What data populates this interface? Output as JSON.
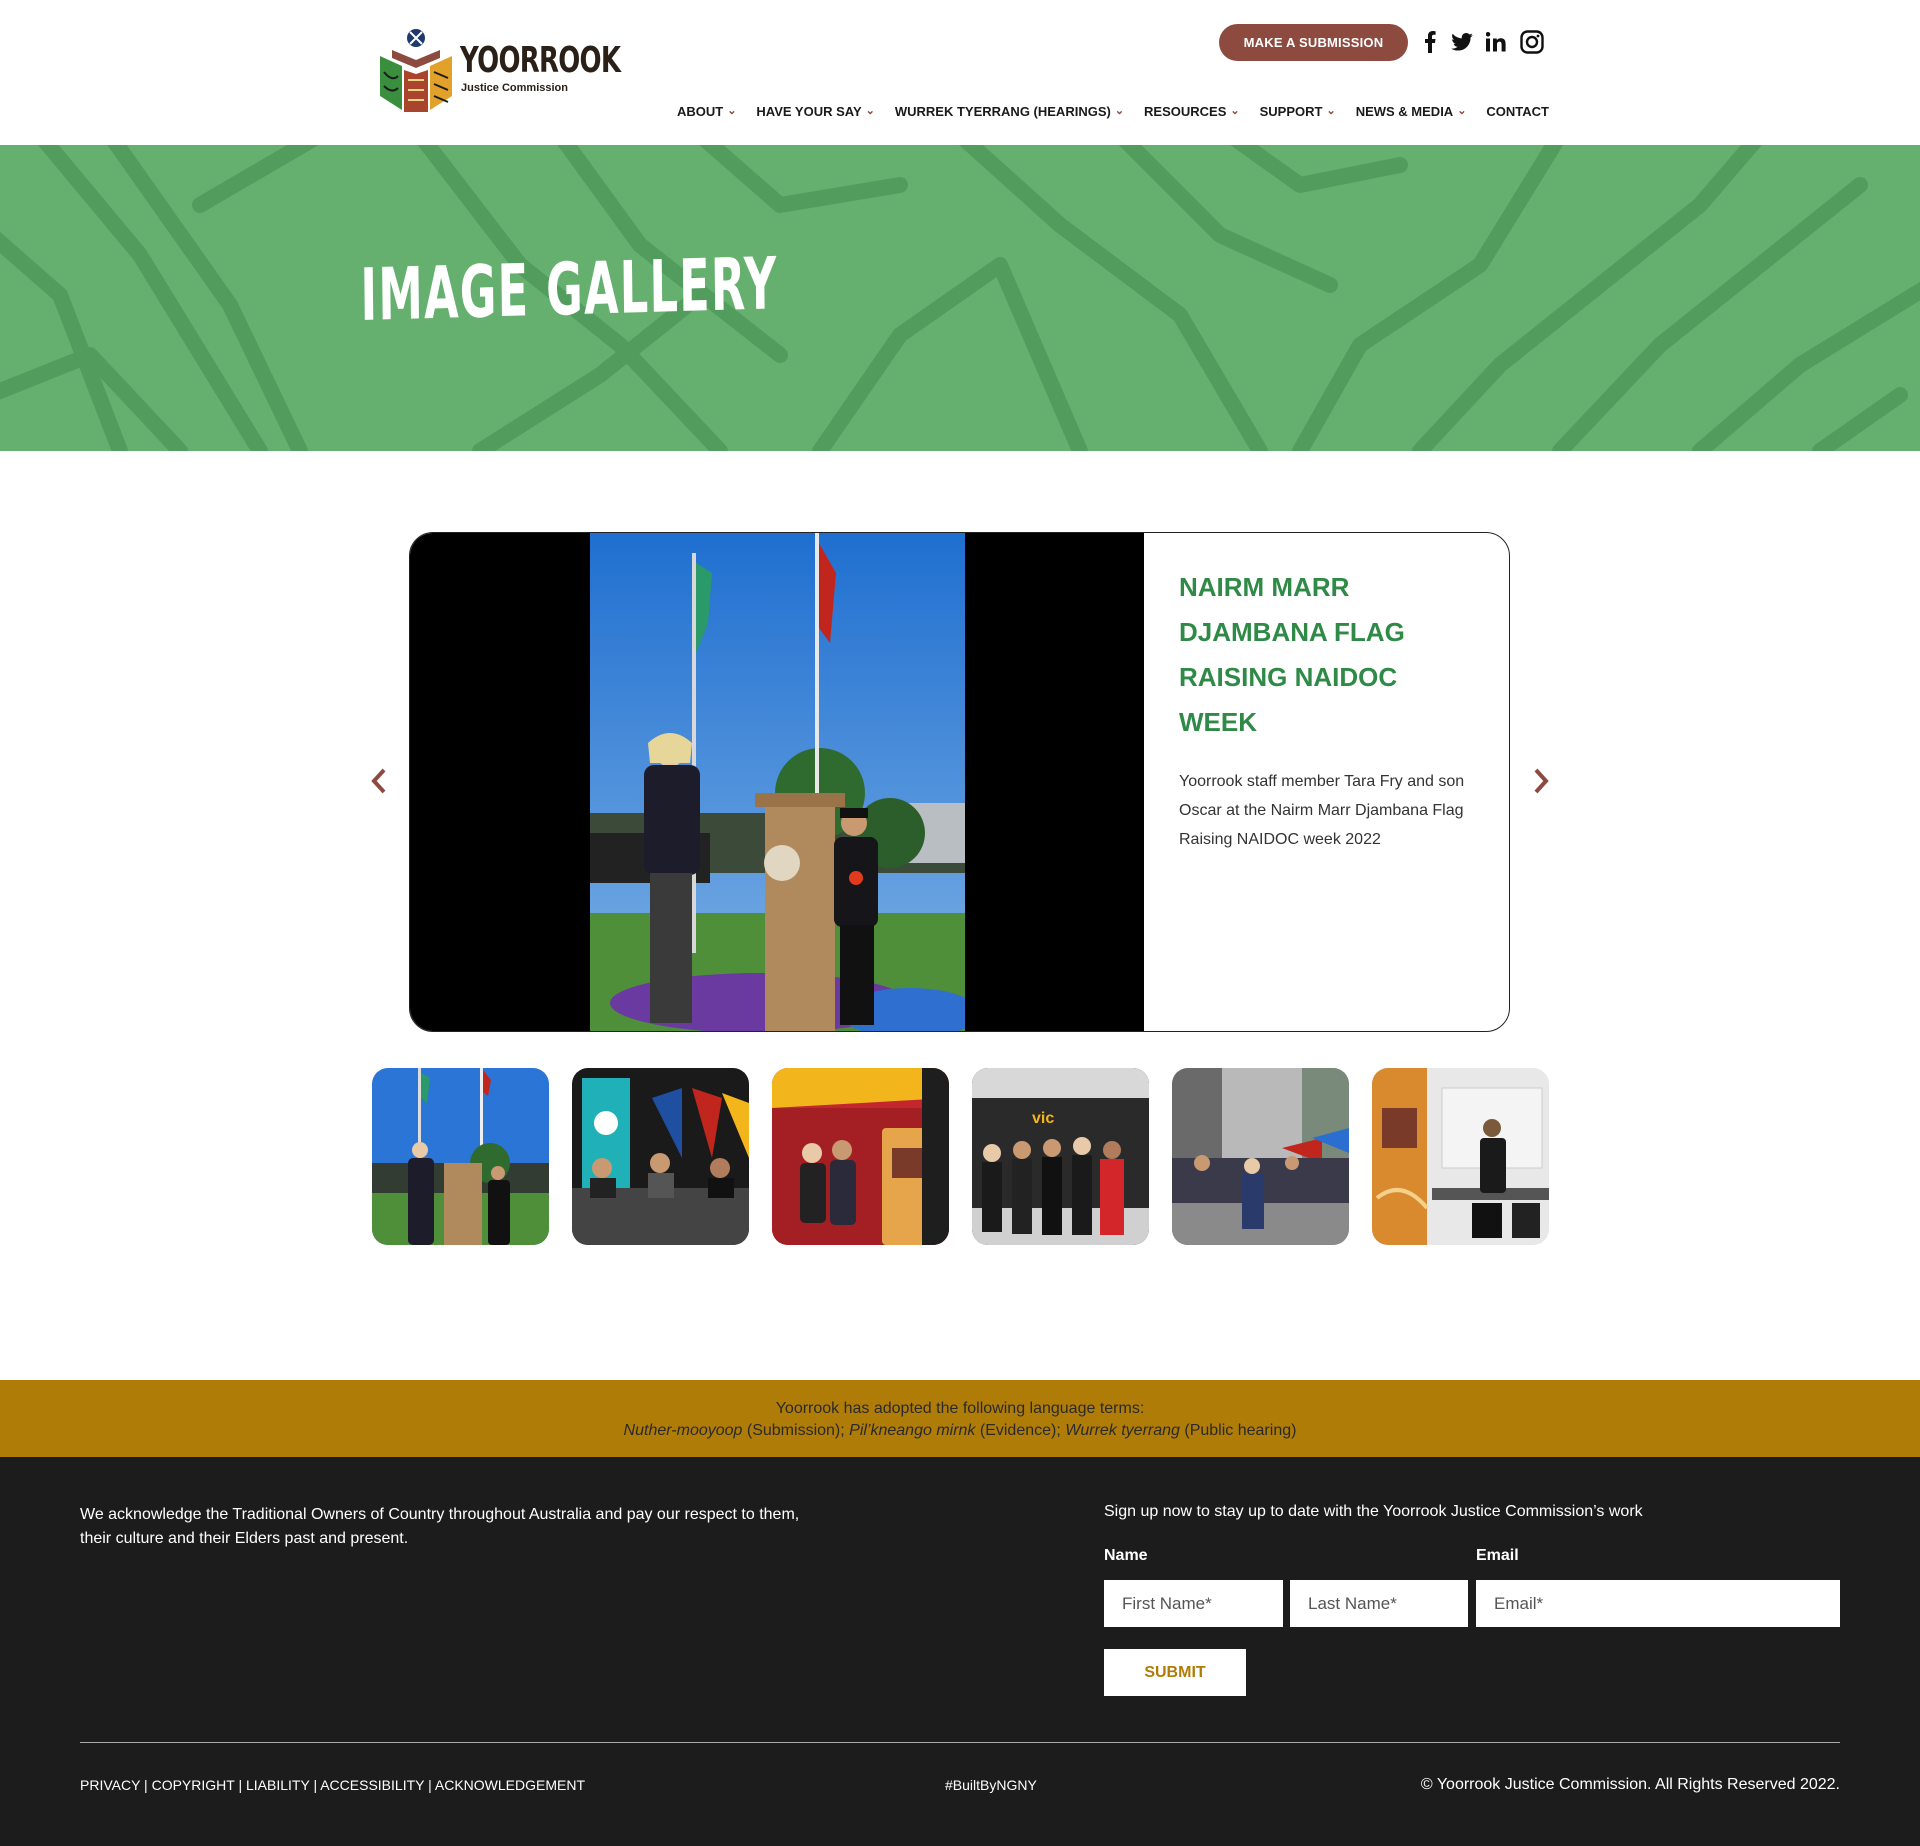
{
  "header": {
    "logo_text": "YOORROOK",
    "logo_subtitle": "Justice Commission",
    "submission_button": "MAKE A SUBMISSION",
    "social_icons": [
      "facebook-icon",
      "twitter-icon",
      "linkedin-icon",
      "instagram-icon"
    ],
    "nav": [
      {
        "label": "ABOUT",
        "has_dropdown": true
      },
      {
        "label": "HAVE YOUR SAY",
        "has_dropdown": true
      },
      {
        "label": "WURREK TYERRANG (HEARINGS)",
        "has_dropdown": true
      },
      {
        "label": "RESOURCES",
        "has_dropdown": true
      },
      {
        "label": "SUPPORT",
        "has_dropdown": true
      },
      {
        "label": "NEWS & MEDIA",
        "has_dropdown": true
      },
      {
        "label": "CONTACT",
        "has_dropdown": false
      }
    ]
  },
  "hero": {
    "title": "IMAGE GALLERY",
    "background_color": "#66b06f",
    "pattern_color": "#4f9a5a"
  },
  "slider": {
    "title": "NAIRM MARR DJAMBANA FLAG RAISING NAIDOC WEEK",
    "description": "Yoorrook staff member Tara Fry and son Oscar at the Nairm Marr Djambana Flag Raising NAIDOC week 2022",
    "prev_icon": "chevron-left-icon",
    "next_icon": "chevron-right-icon",
    "title_color": "#2f8a47"
  },
  "thumbnails": [
    {
      "name": "thumb-flag-raising"
    },
    {
      "name": "thumb-moreland-event"
    },
    {
      "name": "thumb-tent-stall"
    },
    {
      "name": "thumb-vic-naidoc"
    },
    {
      "name": "thumb-street-march"
    },
    {
      "name": "thumb-information-stall"
    }
  ],
  "language_band": {
    "intro": "Yoorrook has adopted the following language terms:",
    "term1": "Nuther-mooyoop",
    "meaning1": " (Submission); ",
    "term2": "Pil’kneango mirnk",
    "meaning2": " (Evidence); ",
    "term3": "Wurrek tyerrang",
    "meaning3": " (Public hearing)",
    "color": "#b07c08"
  },
  "footer": {
    "acknowledgement": "We acknowledge the Traditional Owners of Country throughout Australia and pay our respect to them, their culture and their Elders past and present.",
    "signup_text": "Sign up now to stay up to date with the Yoorrook Justice Commission’s work",
    "name_label": "Name",
    "email_label": "Email",
    "first_name_placeholder": "First Name*",
    "last_name_placeholder": "Last Name*",
    "email_placeholder": "Email*",
    "submit_label": "SUBMIT",
    "legal_links": [
      "PRIVACY",
      "COPYRIGHT",
      "LIABILITY",
      "ACCESSIBILITY",
      "ACKNOWLEDGEMENT"
    ],
    "separator": " | ",
    "built_by": "#BuiltByNGNY",
    "copyright": "© Yoorrook Justice Commission. All Rights Reserved 2022."
  }
}
